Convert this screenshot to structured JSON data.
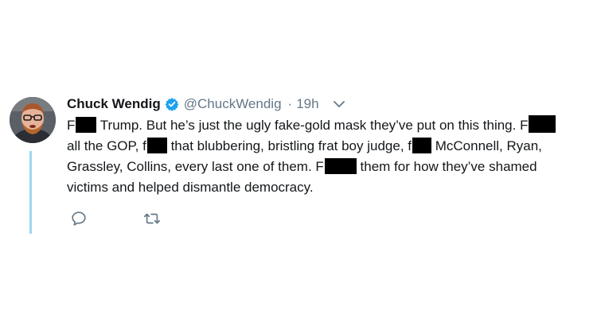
{
  "tweet": {
    "author_name": "Chuck Wendig",
    "handle": "@ChuckWendig",
    "separator": "·",
    "time": "19h",
    "body": {
      "line1": {
        "p1": "F",
        "p2": " Trump. But he’s just the ugly fake-gold mask they’ve put on this thing. F"
      },
      "line2": {
        "p1": "all the GOP, f",
        "p2": " that blubbering, bristling frat boy judge, f",
        "p3": " McConnell, Ryan,"
      },
      "line3": {
        "p1": "Grassley, Collins, every last one of them. F",
        "p2": " them for how they’ve shamed"
      },
      "line4": {
        "p1": "victims and helped dismantle democracy."
      }
    },
    "icons": {
      "verified": "verified-badge-icon",
      "menu": "chevron-down-icon",
      "reply": "reply-icon",
      "retweet": "retweet-icon"
    },
    "colors": {
      "verified": "#1da1f2",
      "thread_line": "#9ad7f3",
      "secondary_text": "#657786",
      "action_icon": "#657786",
      "redaction": "#000000"
    }
  }
}
